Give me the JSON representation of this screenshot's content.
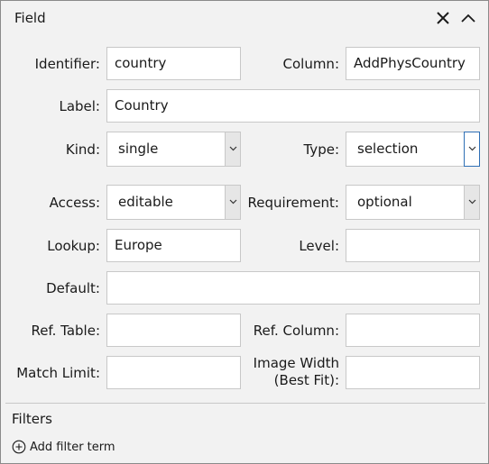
{
  "panel": {
    "title": "Field"
  },
  "header_icons": {
    "close": "close-icon",
    "collapse": "chevron-up-icon"
  },
  "fields": {
    "identifier": {
      "label": "Identifier:",
      "value": "country"
    },
    "column": {
      "label": "Column:",
      "value": "AddPhysCountry"
    },
    "label": {
      "label": "Label:",
      "value": "Country"
    },
    "kind": {
      "label": "Kind:",
      "value": "single"
    },
    "type": {
      "label": "Type:",
      "value": "selection"
    },
    "access": {
      "label": "Access:",
      "value": "editable"
    },
    "requirement": {
      "label": "Requirement:",
      "value": "optional"
    },
    "lookup": {
      "label": "Lookup:",
      "value": "Europe"
    },
    "level": {
      "label": "Level:",
      "value": ""
    },
    "default": {
      "label": "Default:",
      "value": ""
    },
    "ref_table": {
      "label": "Ref. Table:",
      "value": ""
    },
    "ref_column": {
      "label": "Ref. Column:",
      "value": ""
    },
    "match_limit": {
      "label": "Match Limit:",
      "value": ""
    },
    "image_width": {
      "label_line1": "Image Width",
      "label_line2": "(Best Fit):",
      "value": ""
    }
  },
  "filters": {
    "title": "Filters",
    "add_label": "Add filter term"
  },
  "colors": {
    "accent": "#2f6fb5",
    "panel_bg": "#f2f2f2",
    "border": "#c8c8c8"
  }
}
